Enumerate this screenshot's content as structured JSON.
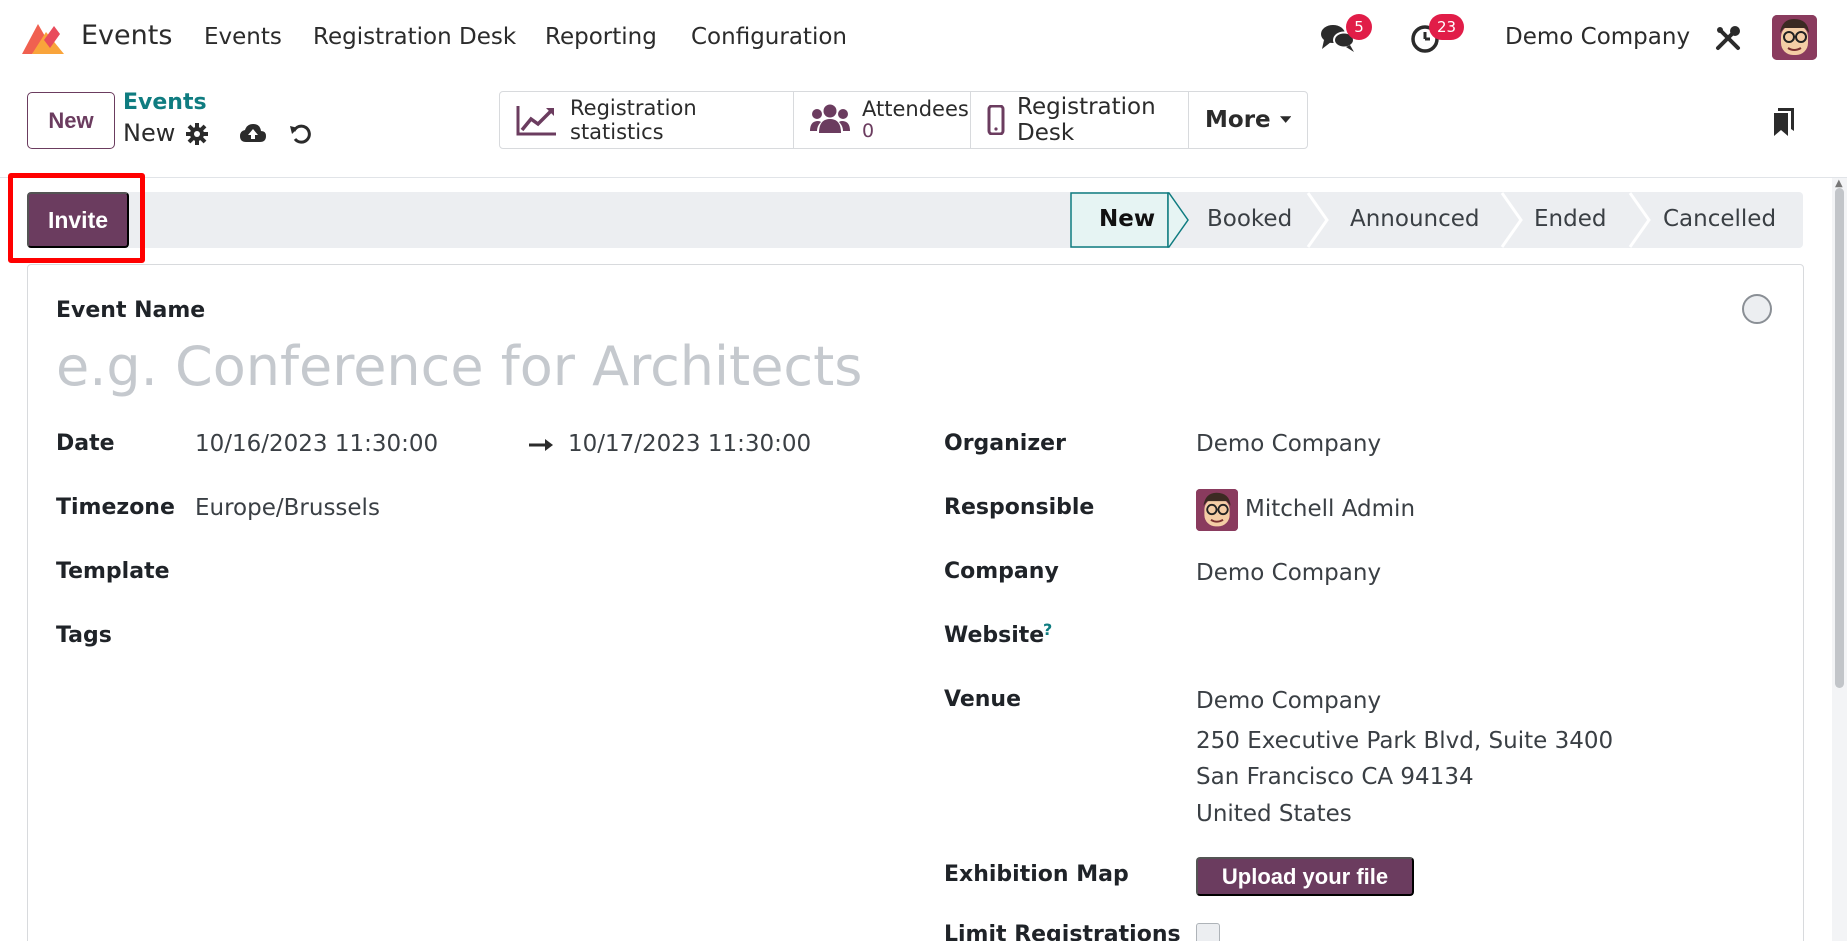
{
  "navbar": {
    "app_name": "Events",
    "menus": [
      "Events",
      "Registration Desk",
      "Reporting",
      "Configuration"
    ],
    "messages_badge": "5",
    "activities_badge": "23",
    "company": "Demo Company"
  },
  "control_panel": {
    "new_button": "New",
    "breadcrumb_parent": "Events",
    "breadcrumb_current": "New",
    "smart_buttons": {
      "registration_statistics": "Registration statistics",
      "attendees_label": "Attendees",
      "attendees_count": "0",
      "registration_desk": "Registration Desk",
      "more": "More"
    }
  },
  "statusbar": {
    "invite_button": "Invite",
    "stages": [
      "New",
      "Booked",
      "Announced",
      "Ended",
      "Cancelled"
    ],
    "active_stage": "New"
  },
  "form": {
    "event_name_label": "Event Name",
    "event_name_placeholder": "e.g. Conference for Architects",
    "date_label": "Date",
    "date_start": "10/16/2023 11:30:00",
    "date_end": "10/17/2023 11:30:00",
    "timezone_label": "Timezone",
    "timezone": "Europe/Brussels",
    "template_label": "Template",
    "tags_label": "Tags",
    "organizer_label": "Organizer",
    "organizer": "Demo Company",
    "responsible_label": "Responsible",
    "responsible": "Mitchell Admin",
    "company_label": "Company",
    "company": "Demo Company",
    "website_label": "Website",
    "website_help": "?",
    "venue_label": "Venue",
    "venue_lines": [
      "Demo Company",
      "250 Executive Park Blvd, Suite 3400",
      "San Francisco CA 94134",
      "United States"
    ],
    "exhibition_map_label": "Exhibition Map",
    "upload_button": "Upload your file",
    "limit_registrations_label": "Limit Registrations"
  },
  "colors": {
    "primary": "#6b3c5f",
    "link": "#0f7c80",
    "badge": "#e11d48",
    "highlight": "#ff0000"
  }
}
